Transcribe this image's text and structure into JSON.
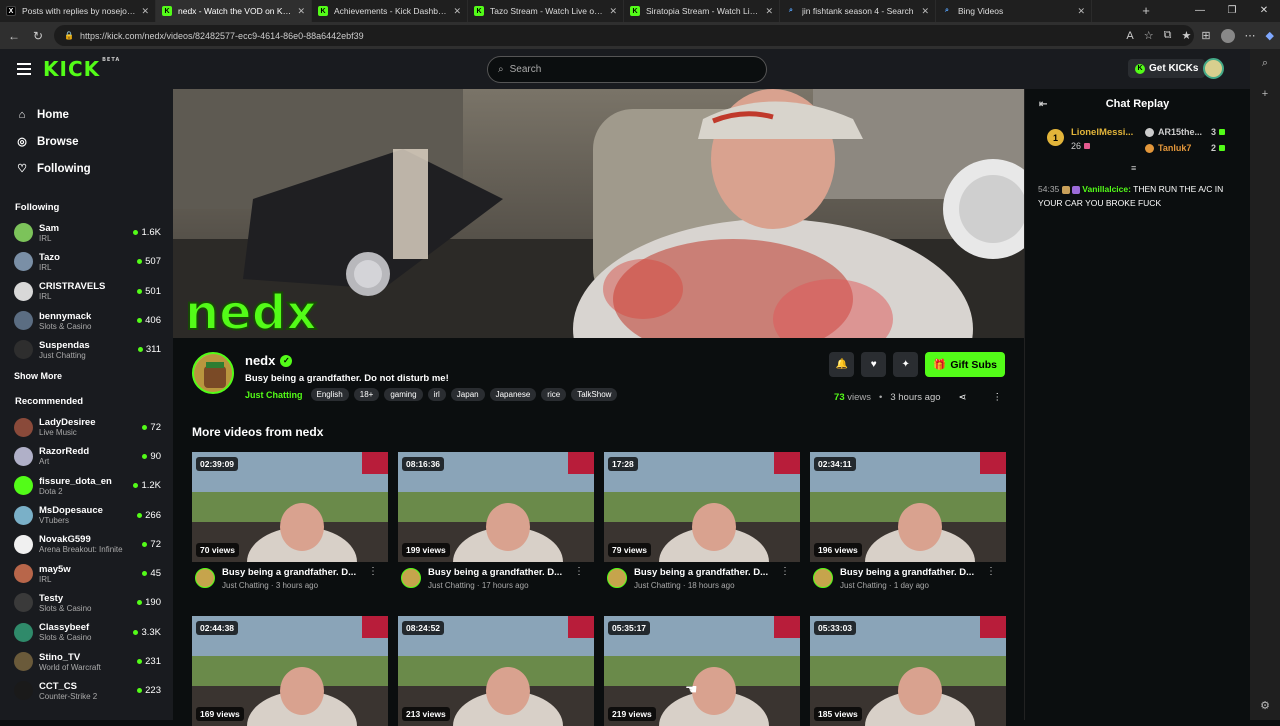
{
  "browser": {
    "tabs": [
      {
        "title": "Posts with replies by nosejosesup",
        "icon": "x",
        "active": false
      },
      {
        "title": "nedx - Watch the VOD on Kick",
        "icon": "kick",
        "active": true
      },
      {
        "title": "Achievements - Kick Dashboard",
        "icon": "kick",
        "active": false
      },
      {
        "title": "Tazo Stream - Watch Live on Kick",
        "icon": "kick",
        "active": false
      },
      {
        "title": "Siratopia Stream - Watch Live on",
        "icon": "kick",
        "active": false
      },
      {
        "title": "jin fishtank season 4 - Search",
        "icon": "bing",
        "active": false
      },
      {
        "title": "Bing Videos",
        "icon": "bing",
        "active": false
      }
    ],
    "url": "https://kick.com/nedx/videos/82482577-ecc9-4614-86e0-88a6442ebf39"
  },
  "header": {
    "logo": "KICK",
    "logo_sup": "BETA",
    "search_placeholder": "Search",
    "get_kicks": "Get KICKs"
  },
  "sidebar": {
    "nav": [
      {
        "label": "Home",
        "icon": "home-icon"
      },
      {
        "label": "Browse",
        "icon": "compass-icon"
      },
      {
        "label": "Following",
        "icon": "heart-icon"
      }
    ],
    "following_title": "Following",
    "following": [
      {
        "name": "Sam",
        "category": "IRL",
        "viewers": "1.6K",
        "color": "#7cc35a"
      },
      {
        "name": "Tazo",
        "category": "IRL",
        "viewers": "507",
        "color": "#7a8fa6"
      },
      {
        "name": "CRISTRAVELS",
        "category": "IRL",
        "viewers": "501",
        "color": "#d8d8d8"
      },
      {
        "name": "bennymack",
        "category": "Slots & Casino",
        "viewers": "406",
        "color": "#5b6d82"
      },
      {
        "name": "Suspendas",
        "category": "Just Chatting",
        "viewers": "311",
        "color": "#2e2e2e"
      }
    ],
    "show_more": "Show More",
    "recommended_title": "Recommended",
    "recommended": [
      {
        "name": "LadyDesiree",
        "category": "Live Music",
        "viewers": "72",
        "color": "#8a4a3a"
      },
      {
        "name": "RazorRedd",
        "category": "Art",
        "viewers": "90",
        "color": "#b0b0c8"
      },
      {
        "name": "fissure_dota_en",
        "category": "Dota 2",
        "viewers": "1.2K",
        "color": "#53fc18"
      },
      {
        "name": "MsDopesauce",
        "category": "VTubers",
        "viewers": "266",
        "color": "#7ab0c8"
      },
      {
        "name": "NovakG599",
        "category": "Arena Breakout: Infinite",
        "viewers": "72",
        "color": "#f0f0f0"
      },
      {
        "name": "may5w",
        "category": "IRL",
        "viewers": "45",
        "color": "#b8664a"
      },
      {
        "name": "Testy",
        "category": "Slots & Casino",
        "viewers": "190",
        "color": "#3a3a3a"
      },
      {
        "name": "Classybeef",
        "category": "Slots & Casino",
        "viewers": "3.3K",
        "color": "#2f8a6a"
      },
      {
        "name": "Stino_TV",
        "category": "World of Warcraft",
        "viewers": "231",
        "color": "#6a5a3a"
      },
      {
        "name": "CCT_CS",
        "category": "Counter-Strike 2",
        "viewers": "223",
        "color": "#1a1a1a"
      }
    ]
  },
  "channel": {
    "name": "nedx",
    "title": "Busy being a grandfather. Do not disturb me!",
    "category": "Just Chatting",
    "tags": [
      "English",
      "18+",
      "gaming",
      "irl",
      "Japan",
      "Japanese",
      "rice",
      "TalkShow"
    ],
    "gift_subs": "Gift Subs",
    "views": "73",
    "views_label": "views",
    "ago": "3 hours ago",
    "video_overlay": "nedx"
  },
  "more_videos": {
    "heading": "More videos from nedx",
    "items": [
      {
        "duration": "02:39:09",
        "views": "70 views",
        "title": "Busy being a grandfather. D...",
        "category": "Just Chatting",
        "ago": "3 hours ago"
      },
      {
        "duration": "08:16:36",
        "views": "199 views",
        "title": "Busy being a grandfather. D...",
        "category": "Just Chatting",
        "ago": "17 hours ago"
      },
      {
        "duration": "17:28",
        "views": "79 views",
        "title": "Busy being a grandfather. D...",
        "category": "Just Chatting",
        "ago": "18 hours ago"
      },
      {
        "duration": "02:34:11",
        "views": "196 views",
        "title": "Busy being a grandfather. D...",
        "category": "Just Chatting",
        "ago": "1 day ago"
      },
      {
        "duration": "02:44:38",
        "views": "169 views",
        "title": "",
        "category": "",
        "ago": ""
      },
      {
        "duration": "08:24:52",
        "views": "213 views",
        "title": "",
        "category": "",
        "ago": ""
      },
      {
        "duration": "05:35:17",
        "views": "219 views",
        "title": "",
        "category": "",
        "ago": ""
      },
      {
        "duration": "05:33:03",
        "views": "185 views",
        "title": "",
        "category": "",
        "ago": ""
      }
    ]
  },
  "chat": {
    "title": "Chat Replay",
    "leaderboard": [
      {
        "rank": "1",
        "name": "LionelMessi...",
        "count": "26"
      },
      {
        "name": "AR15the...",
        "count": "3"
      },
      {
        "name": "Tanluk7",
        "count": "2"
      }
    ],
    "messages": [
      {
        "time": "54:35",
        "user": "Vanillalcice:",
        "text": "THEN RUN THE A/C IN YOUR CAR YOU BROKE FUCK"
      }
    ]
  }
}
